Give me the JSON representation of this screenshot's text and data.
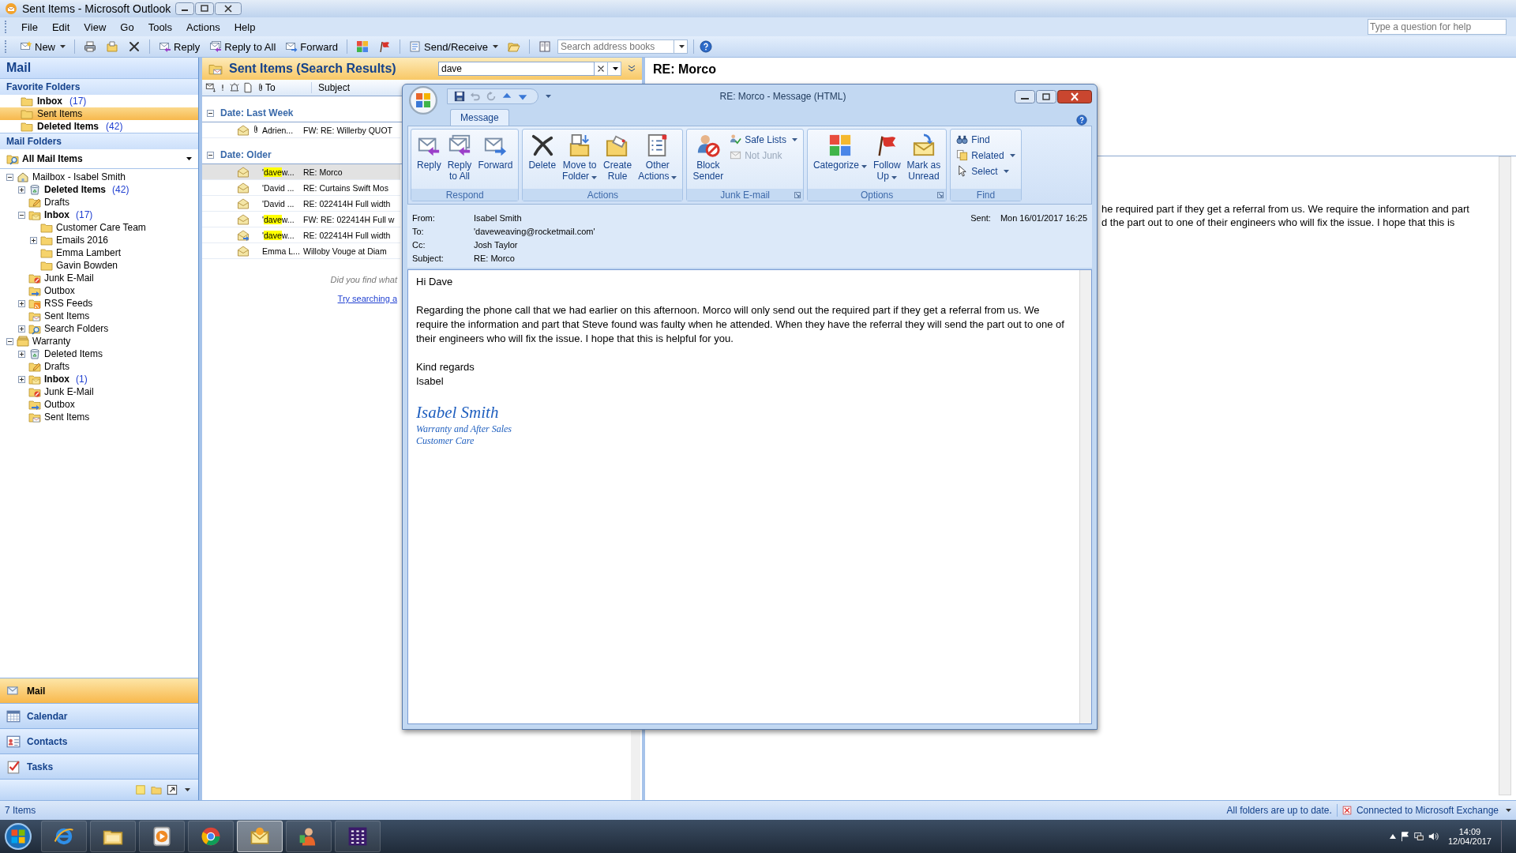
{
  "window": {
    "title": "Sent Items - Microsoft Outlook"
  },
  "menu": [
    "File",
    "Edit",
    "View",
    "Go",
    "Tools",
    "Actions",
    "Help"
  ],
  "help_box": {
    "placeholder": "Type a question for help"
  },
  "toolbar": [
    {
      "kind": "new",
      "label": "New",
      "dropdown": true
    },
    {
      "kind": "separator"
    },
    {
      "kind": "print"
    },
    {
      "kind": "move"
    },
    {
      "kind": "delete"
    },
    {
      "kind": "separator"
    },
    {
      "kind": "reply",
      "label": "Reply"
    },
    {
      "kind": "reply-all",
      "label": "Reply to All"
    },
    {
      "kind": "forward",
      "label": "Forward"
    },
    {
      "kind": "separator"
    },
    {
      "kind": "categorize"
    },
    {
      "kind": "flag"
    },
    {
      "kind": "separator"
    },
    {
      "kind": "send-receive",
      "label": "Send/Receive",
      "dropdown": true
    },
    {
      "kind": "open-folder"
    },
    {
      "kind": "separator"
    },
    {
      "kind": "address-book"
    }
  ],
  "address_search": {
    "placeholder": "Search address books"
  },
  "nav": {
    "title": "Mail",
    "favorites_title": "Favorite Folders",
    "favorites": [
      {
        "name": "Inbox",
        "count": "(17)",
        "bold": true,
        "selected": false
      },
      {
        "name": "Sent Items",
        "bold": false,
        "selected": true
      },
      {
        "name": "Deleted Items",
        "count": "(42)",
        "bold": true,
        "selected": false
      }
    ],
    "folders_title": "Mail Folders",
    "view_selector": "All Mail Items",
    "tree": [
      {
        "name": "Mailbox - Isabel Smith",
        "kind": "mailbox",
        "bold": false,
        "expanded": true,
        "children": [
          {
            "name": "Deleted Items",
            "kind": "trash",
            "bold": true,
            "count": "(42)",
            "expanded": false
          },
          {
            "name": "Drafts",
            "kind": "drafts",
            "bold": false
          },
          {
            "name": "Inbox",
            "kind": "inbox",
            "bold": true,
            "count": "(17)",
            "expanded": true,
            "children": [
              {
                "name": "Customer Care Team",
                "kind": "folder",
                "bold": false
              },
              {
                "name": "Emails 2016",
                "kind": "folder",
                "bold": false,
                "expanded": false
              },
              {
                "name": "Emma Lambert",
                "kind": "folder",
                "bold": false
              },
              {
                "name": "Gavin Bowden",
                "kind": "folder",
                "bold": false
              }
            ]
          },
          {
            "name": "Junk E-Mail",
            "kind": "junk",
            "bold": false
          },
          {
            "name": "Outbox",
            "kind": "outbox",
            "bold": false
          },
          {
            "name": "RSS Feeds",
            "kind": "rss",
            "bold": false,
            "expanded": false
          },
          {
            "name": "Sent Items",
            "kind": "sent",
            "bold": false
          },
          {
            "name": "Search Folders",
            "kind": "search-folder",
            "bold": false,
            "expanded": false
          }
        ]
      },
      {
        "name": "Warranty",
        "kind": "archive",
        "bold": false,
        "expanded": true,
        "children": [
          {
            "name": "Deleted Items",
            "kind": "trash",
            "bold": false,
            "expanded": false
          },
          {
            "name": "Drafts",
            "kind": "drafts",
            "bold": false
          },
          {
            "name": "Inbox",
            "kind": "inbox",
            "bold": true,
            "count": "(1)",
            "expanded": false
          },
          {
            "name": "Junk E-Mail",
            "kind": "junk",
            "bold": false
          },
          {
            "name": "Outbox",
            "kind": "outbox",
            "bold": false
          },
          {
            "name": "Sent Items",
            "kind": "sent",
            "bold": false
          }
        ]
      }
    ],
    "buttons": [
      {
        "label": "Mail",
        "kind": "mail",
        "selected": true
      },
      {
        "label": "Calendar",
        "kind": "calendar",
        "selected": false
      },
      {
        "label": "Contacts",
        "kind": "contacts",
        "selected": false
      },
      {
        "label": "Tasks",
        "kind": "tasks",
        "selected": false
      }
    ]
  },
  "message_list": {
    "title": "Sent Items (Search Results)",
    "search": {
      "value": "dave"
    },
    "columns": [
      "To",
      "Subject"
    ],
    "groups": [
      {
        "label": "Date: Last Week",
        "expanded": true,
        "rows": [
          {
            "kind": "read",
            "attachment": true,
            "selected": false,
            "to": [
              {
                "text": "Adrien...",
                "hit": false
              }
            ],
            "subject": "FW: RE: Willerby QUOT"
          }
        ]
      },
      {
        "label": "Date: Older",
        "expanded": true,
        "rows": [
          {
            "kind": "read",
            "attachment": false,
            "selected": true,
            "to": [
              {
                "text": "'",
                "hit": false
              },
              {
                "text": "dave",
                "hit": true
              },
              {
                "text": "w...",
                "hit": false
              }
            ],
            "subject": "RE: Morco"
          },
          {
            "kind": "read",
            "attachment": false,
            "selected": false,
            "to": [
              {
                "text": "'David ...",
                "hit": false
              }
            ],
            "subject": "RE: Curtains Swift Mos"
          },
          {
            "kind": "read",
            "attachment": false,
            "selected": false,
            "to": [
              {
                "text": "'David ...",
                "hit": false
              }
            ],
            "subject": "RE: 022414H Full width"
          },
          {
            "kind": "read",
            "attachment": false,
            "selected": false,
            "to": [
              {
                "text": "'",
                "hit": false
              },
              {
                "text": "dave",
                "hit": true
              },
              {
                "text": "w...",
                "hit": false
              }
            ],
            "subject": "FW: RE: 022414H Full w"
          },
          {
            "kind": "forwarded",
            "attachment": false,
            "selected": false,
            "to": [
              {
                "text": "'",
                "hit": false
              },
              {
                "text": "dave",
                "hit": true
              },
              {
                "text": "w...",
                "hit": false
              }
            ],
            "subject": "RE: 022414H Full width"
          },
          {
            "kind": "read",
            "attachment": false,
            "selected": false,
            "to": [
              {
                "text": "Emma L...",
                "hit": false
              }
            ],
            "subject": "Willoby Vouge at Diam"
          }
        ]
      }
    ],
    "footer_note": "Did you find what",
    "footer_link": "Try searching a"
  },
  "reading_pane": {
    "subject": "RE: Morco",
    "lines": [
      "he required part if they get a referral from us. We require the information and part",
      "d the part out to one of their engineers who will fix the issue. I hope that this is"
    ]
  },
  "message_window": {
    "title": "RE: Morco - Message (HTML)",
    "tabs": [
      {
        "label": "Message",
        "selected": true
      }
    ],
    "ribbon": [
      {
        "label": "Respond",
        "launcher": false,
        "large_buttons": [
          {
            "kind": "reply",
            "label": "Reply",
            "dropdown": false,
            "disabled": false
          },
          {
            "kind": "reply-all",
            "label": "Reply\nto All",
            "dropdown": false,
            "disabled": false
          },
          {
            "kind": "forward",
            "label": "Forward",
            "dropdown": false,
            "disabled": false
          }
        ]
      },
      {
        "label": "Actions",
        "launcher": false,
        "large_buttons": [
          {
            "kind": "delete-big",
            "label": "Delete",
            "dropdown": false,
            "disabled": false
          },
          {
            "kind": "move-folder",
            "label": "Move to\nFolder",
            "dropdown": true,
            "disabled": false
          },
          {
            "kind": "create-rule",
            "label": "Create\nRule",
            "dropdown": false,
            "disabled": false
          },
          {
            "kind": "other-actions",
            "label": "Other\nActions",
            "dropdown": true,
            "disabled": false
          }
        ]
      },
      {
        "label": "Junk E-mail",
        "launcher": true,
        "large_buttons": [
          {
            "kind": "block-sender",
            "label": "Block\nSender",
            "dropdown": false,
            "disabled": false
          }
        ],
        "small_buttons": [
          {
            "kind": "safe-lists",
            "label": "Safe Lists",
            "dropdown": true,
            "disabled": false
          },
          {
            "kind": "not-junk",
            "label": "Not Junk",
            "dropdown": false,
            "disabled": true
          }
        ]
      },
      {
        "label": "Options",
        "launcher": true,
        "large_buttons": [
          {
            "kind": "categorize",
            "label": "Categorize",
            "dropdown": true,
            "disabled": false
          },
          {
            "kind": "flag",
            "label": "Follow\nUp",
            "dropdown": true,
            "disabled": false
          },
          {
            "kind": "mark-unread",
            "label": "Mark as\nUnread",
            "dropdown": false,
            "disabled": false
          }
        ]
      },
      {
        "label": "Find",
        "launcher": false,
        "small_buttons": [
          {
            "kind": "find",
            "label": "Find",
            "dropdown": false,
            "disabled": false
          },
          {
            "kind": "related",
            "label": "Related",
            "dropdown": true,
            "disabled": false
          },
          {
            "kind": "select",
            "label": "Select",
            "dropdown": true,
            "disabled": false
          }
        ]
      }
    ],
    "fields": [
      {
        "label": "From:",
        "value": "Isabel Smith"
      },
      {
        "label": "To:",
        "value": "'daveweaving@rocketmail.com'"
      },
      {
        "label": "Cc:",
        "value": "Josh Taylor"
      },
      {
        "label": "Subject:",
        "value": "RE: Morco"
      }
    ],
    "sent": {
      "label": "Sent:",
      "value": "Mon 16/01/2017 16:25"
    },
    "body": {
      "greeting": "Hi Dave",
      "paragraph": "Regarding the phone call that we had earlier on this afternoon. Morco will only send out the required part if they get a referral from us. We require the information and part that Steve found was faulty when he attended. When they have the referral they will send the part out to one of their engineers who will fix the issue. I hope that this is helpful for you.",
      "closing": [
        "Kind regards",
        "Isabel"
      ],
      "signature": {
        "name": "Isabel Smith",
        "lines": [
          "Warranty and After Sales",
          "Customer Care"
        ]
      }
    }
  },
  "status_bar": {
    "items_count": "7 Items",
    "sync": "All folders are up to date.",
    "connection": "Connected to Microsoft Exchange"
  },
  "taskbar": {
    "apps": [
      {
        "kind": "browser",
        "selected": false
      },
      {
        "kind": "file-manager",
        "selected": false
      },
      {
        "kind": "media-player",
        "selected": false
      },
      {
        "kind": "web-browser",
        "selected": false
      },
      {
        "kind": "mail-app",
        "selected": true
      },
      {
        "kind": "person-app",
        "selected": false
      },
      {
        "kind": "calculator",
        "selected": false
      }
    ],
    "time": "14:09",
    "date": "12/04/2017"
  }
}
